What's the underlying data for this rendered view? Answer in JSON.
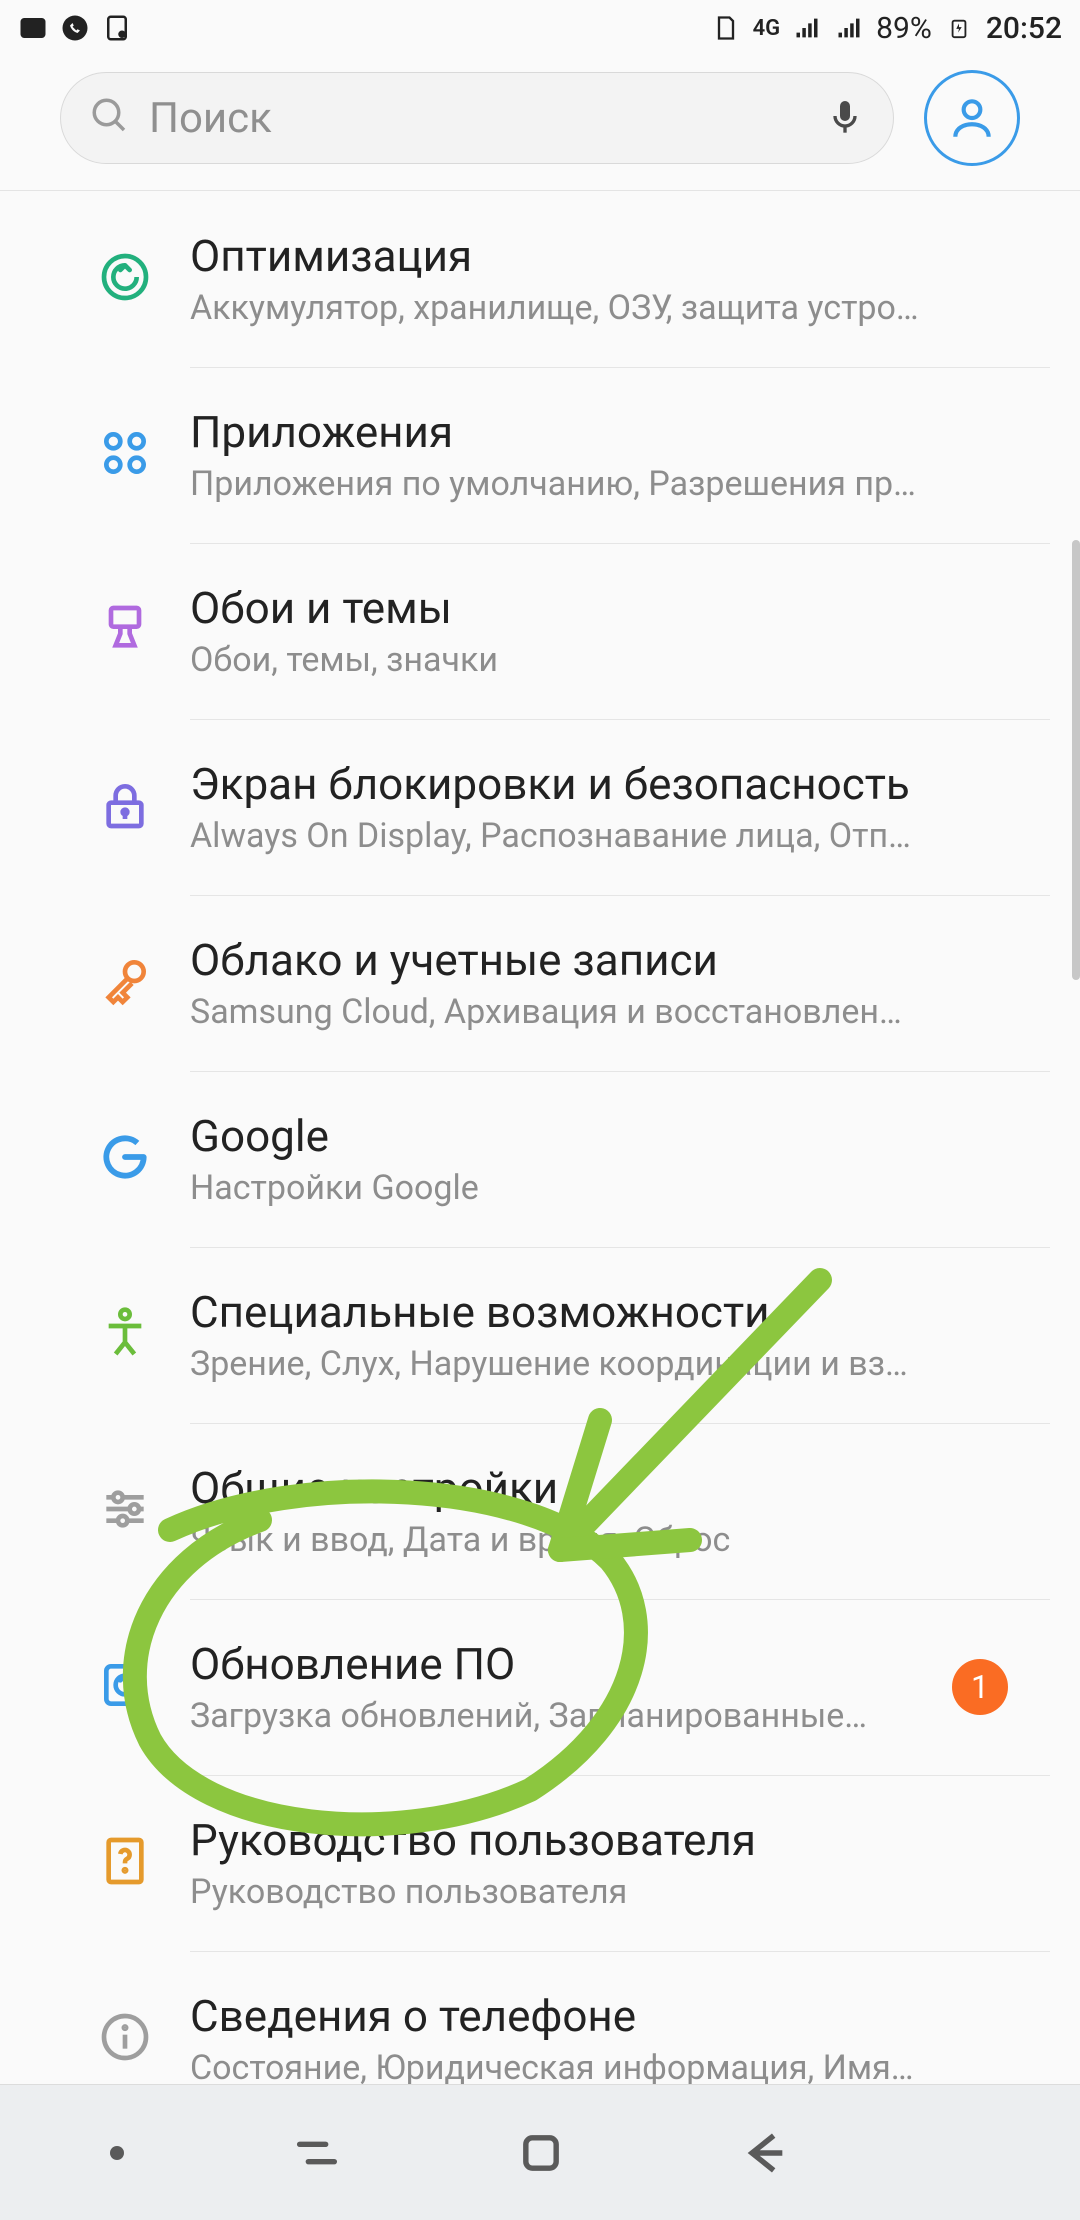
{
  "status_bar": {
    "network_label": "4G",
    "battery_pct": "89%",
    "time": "20:52"
  },
  "search": {
    "placeholder": "Поиск"
  },
  "items": [
    {
      "id": "optimization",
      "title": "Оптимизация",
      "sub": "Аккумулятор, хранилище, ОЗУ, защита устройства",
      "icon": "refresh-circle",
      "color": "#22b07d",
      "badge": ""
    },
    {
      "id": "apps",
      "title": "Приложения",
      "sub": "Приложения по умолчанию, Разрешения прилож…",
      "icon": "apps-grid",
      "color": "#3a9be8",
      "badge": ""
    },
    {
      "id": "wallpapers",
      "title": "Обои и темы",
      "sub": "Обои, темы, значки",
      "icon": "brush",
      "color": "#b06adf",
      "badge": ""
    },
    {
      "id": "lockscreen",
      "title": "Экран блокировки и безопасность",
      "sub": "Always On Display, Распознавание лица, Отпечатк…",
      "icon": "lock",
      "color": "#7d6de0",
      "badge": ""
    },
    {
      "id": "cloud-accounts",
      "title": "Облако и учетные записи",
      "sub": "Samsung Cloud, Архивация и восстановление, Sm…",
      "icon": "key",
      "color": "#f0843a",
      "badge": ""
    },
    {
      "id": "google",
      "title": "Google",
      "sub": "Настройки Google",
      "icon": "google-g",
      "color": "#3a9be8",
      "badge": ""
    },
    {
      "id": "accessibility",
      "title": "Специальные возможности",
      "sub": "Зрение, Слух, Нарушение координации и взаимо…",
      "icon": "person",
      "color": "#6bbd3b",
      "badge": ""
    },
    {
      "id": "general",
      "title": "Общие настройки",
      "sub": "Язык и ввод, Дата и время, Сброс",
      "icon": "sliders",
      "color": "#9e9e9e",
      "badge": ""
    },
    {
      "id": "software-update",
      "title": "Обновление ПО",
      "sub": "Загрузка обновлений, Запланированные…",
      "icon": "update-box",
      "color": "#3a9be8",
      "badge": "1"
    },
    {
      "id": "user-manual",
      "title": "Руководство пользователя",
      "sub": "Руководство пользователя",
      "icon": "help-book",
      "color": "#e59a2c",
      "badge": ""
    },
    {
      "id": "about-phone",
      "title": "Сведения о телефоне",
      "sub": "Состояние, Юридическая информация, Имя устр…",
      "icon": "info-circle",
      "color": "#9e9e9e",
      "badge": ""
    }
  ],
  "annotation_color": "#8cc63f"
}
